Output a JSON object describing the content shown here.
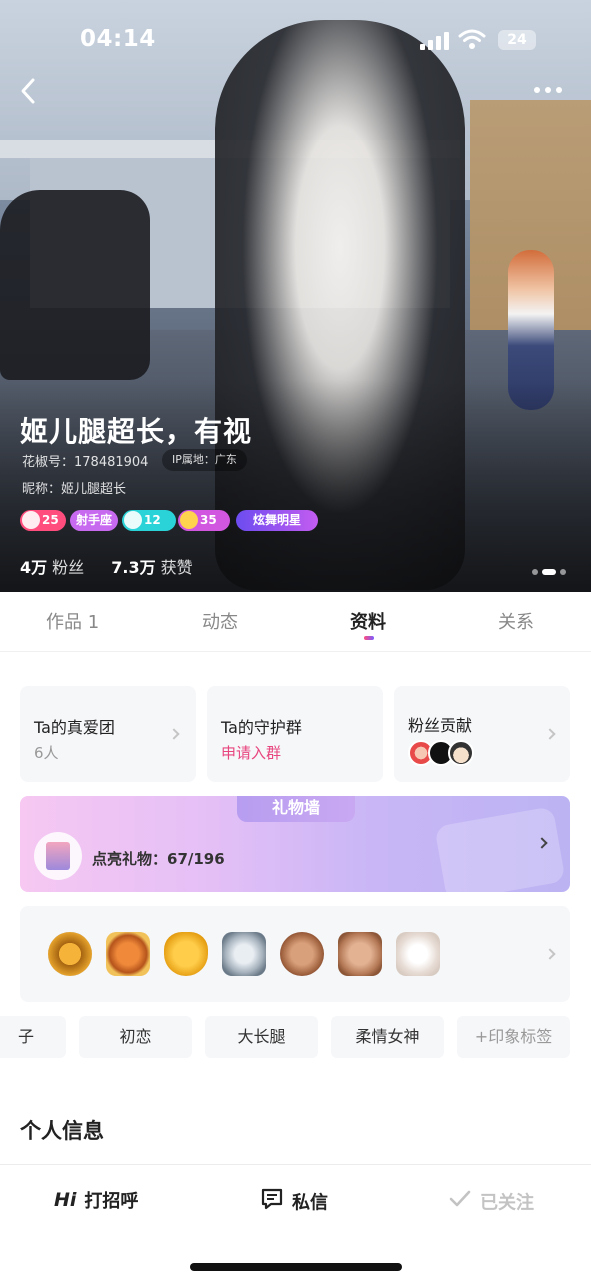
{
  "status_bar": {
    "time": "04:14",
    "battery": "24"
  },
  "profile": {
    "name": "姬儿腿超长，有视",
    "id_label": "花椒号：178481904",
    "ip_label": "IP属地：广东",
    "nickname_label": "昵称：姬儿腿超长",
    "badges": [
      {
        "text": "25",
        "color": "#ff4d7d"
      },
      {
        "text": "射手座",
        "color": "#c86af0"
      },
      {
        "text": "12",
        "color": "#2ad3d8"
      },
      {
        "text": "35",
        "color": "#d257e0"
      },
      {
        "text": "炫舞明星",
        "color": "#9b5cf3"
      }
    ],
    "fans_value": "4万",
    "fans_label": "粉丝",
    "likes_value": "7.3万",
    "likes_label": "获赞"
  },
  "tabs": [
    {
      "label": "作品 1"
    },
    {
      "label": "动态"
    },
    {
      "label": "资料"
    },
    {
      "label": "关系"
    }
  ],
  "cards": {
    "fanclub": {
      "title": "Ta的真爱团",
      "sub": "6人"
    },
    "guard": {
      "title": "Ta的守护群",
      "sub": "申请入群"
    },
    "contrib": {
      "title": "粉丝贡献"
    }
  },
  "gift_wall": {
    "header": "礼物墙",
    "label": "点亮礼物：",
    "progress": "67/196",
    "lit": 67,
    "total": 196
  },
  "medal_icons": [
    "gold-medal-icon",
    "bronze-question-medal-icon",
    "gold-heart-medal-icon",
    "silver-play-medal-icon",
    "bronze-30k-medal-icon",
    "bronze-group-medal-icon",
    "faded-medal-icon"
  ],
  "tags": [
    "子",
    "初恋",
    "大长腿",
    "柔情女神",
    "+印象标签"
  ],
  "section_title": "个人信息",
  "bottom_bar": {
    "greet_prefix": "Hi",
    "greet": "打招呼",
    "message": "私信",
    "followed": "已关注"
  }
}
